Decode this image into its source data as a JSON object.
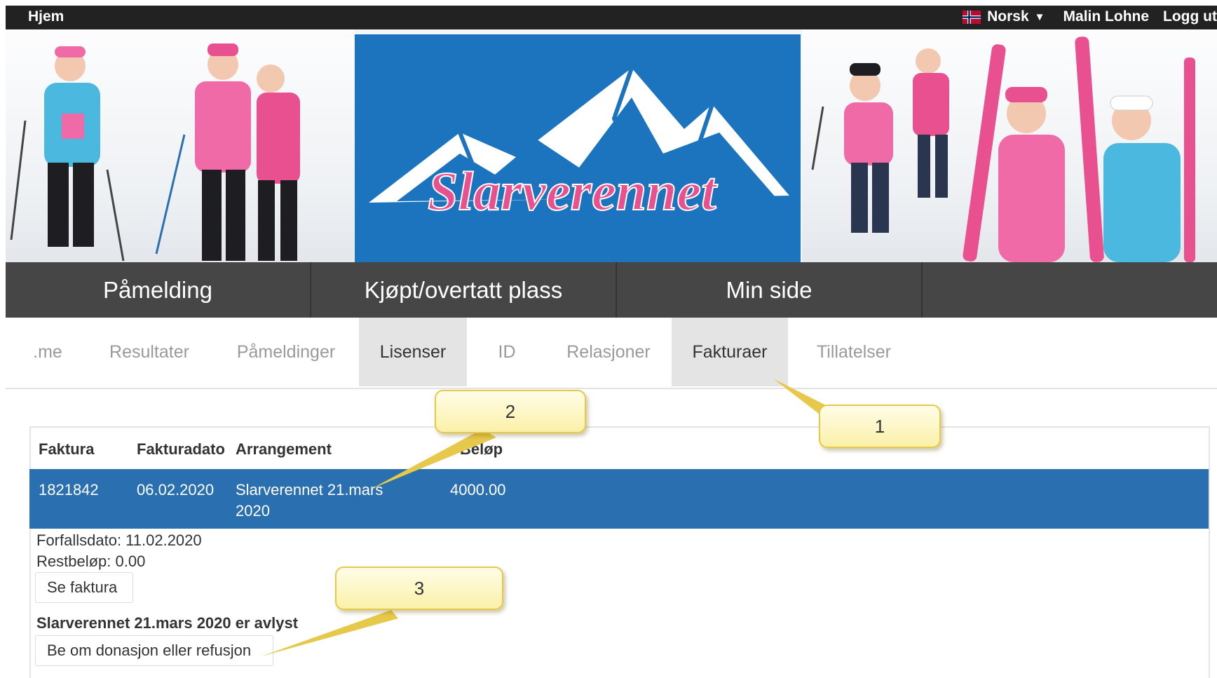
{
  "topbar": {
    "home": "Hjem",
    "language": "Norsk",
    "user": "Malin Lohne",
    "logout": "Logg ut"
  },
  "banner": {
    "logo_text": "Slarverennet"
  },
  "main_nav": [
    "Påmelding",
    "Kjøpt/overtatt plass",
    "Min side"
  ],
  "tabs": [
    {
      "label": ".me"
    },
    {
      "label": "Resultater"
    },
    {
      "label": "Påmeldinger"
    },
    {
      "label": "Lisenser"
    },
    {
      "label": "ID"
    },
    {
      "label": "Relasjoner"
    },
    {
      "label": "Fakturaer"
    },
    {
      "label": "Tillatelser"
    }
  ],
  "invoice_table": {
    "headers": {
      "invoice": "Faktura",
      "date": "Fakturadato",
      "event": "Arrangement",
      "amount": "Beløp"
    },
    "row": {
      "invoice": "1821842",
      "date": "06.02.2020",
      "event_line1": "Slarverennet 21.mars",
      "event_line2": "2020",
      "amount": "4000.00"
    },
    "details": {
      "due_date": "Forfallsdato: 11.02.2020",
      "remaining": "Restbeløp: 0.00",
      "view_button": "Se faktura",
      "cancel_notice": "Slarverennet 21.mars 2020 er avlyst",
      "refund_button": "Be om donasjon eller refusjon"
    }
  },
  "callouts": [
    "1",
    "2",
    "3"
  ],
  "colors": {
    "topbar": "#222222",
    "logo_background": "#1b74bd",
    "logo_pink": "#e8508f",
    "main_nav": "#464646",
    "selected_row": "#2a6fb0",
    "callout": "#fbf0a8"
  }
}
